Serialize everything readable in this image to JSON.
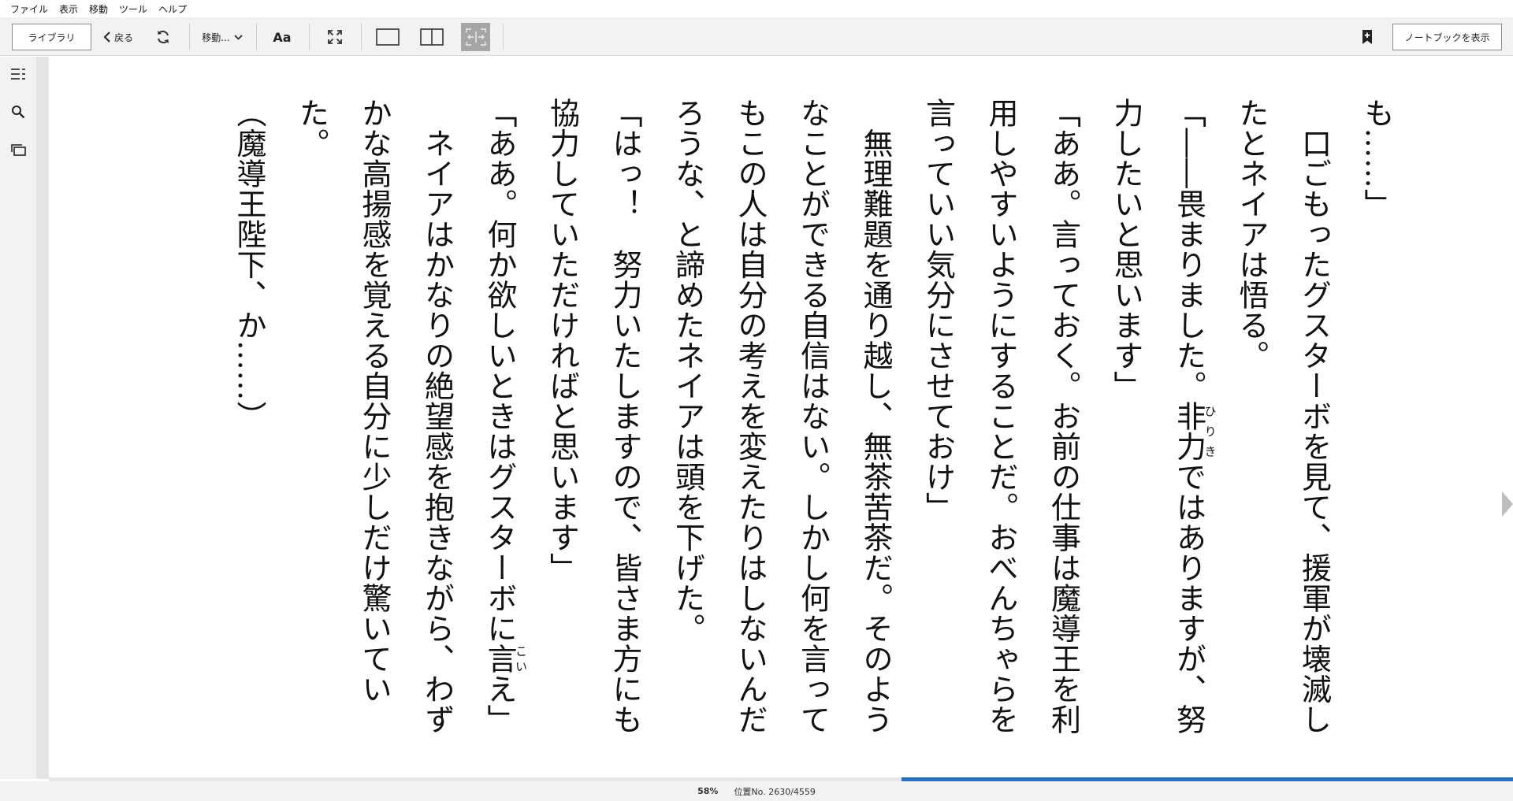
{
  "menu": [
    "ファイル",
    "表示",
    "移動",
    "ツール",
    "ヘルプ"
  ],
  "toolbar": {
    "library_label": "ライブラリ",
    "back_label": "戻る",
    "goto_label": "移動...",
    "font_label": "Aa",
    "notebook_label": "ノートブックを表示"
  },
  "reader": {
    "lines": [
      "も……」",
      "　口ごもったグスターボを見て、援軍が壊滅し",
      "たとネイアは悟る。",
      "「――畏まりました。非力ではありますが、努",
      "力したいと思います」",
      "「ああ。言っておく。お前の仕事は魔導王を利",
      "用しやすいようにすることだ。おべんちゃらを",
      "言っていい気分にさせておけ」",
      "　無理難題を通り越し、無茶苦茶だ。そのよう",
      "なことができる自信はない。しかし何を言って",
      "もこの人は自分の考えを変えたりはしないんだ",
      "ろうな、と諦めたネイアは頭を下げた。",
      "「はっ！　努力いたしますので、皆さま方にも",
      "協力していただければと思います」",
      "「ああ。何か欲しいときはグスターボに言え」",
      "　ネイアはかなりの絶望感を抱きながら、わず",
      "かな高揚感を覚える自分に少しだけ驚いていた。",
      "（魔導王陛下、か……）"
    ],
    "ruby": [
      {
        "base": "非力",
        "reading": "ひりき"
      },
      {
        "base": "言",
        "reading": "こい"
      }
    ]
  },
  "status": {
    "percent": "58%",
    "location": "位置No. 2630/4559",
    "progress_fraction": 0.58
  },
  "colors": {
    "progress": "#2a6ebd",
    "toolbar_bg": "#f2f2f2",
    "active_view": "#a6a6a6"
  }
}
